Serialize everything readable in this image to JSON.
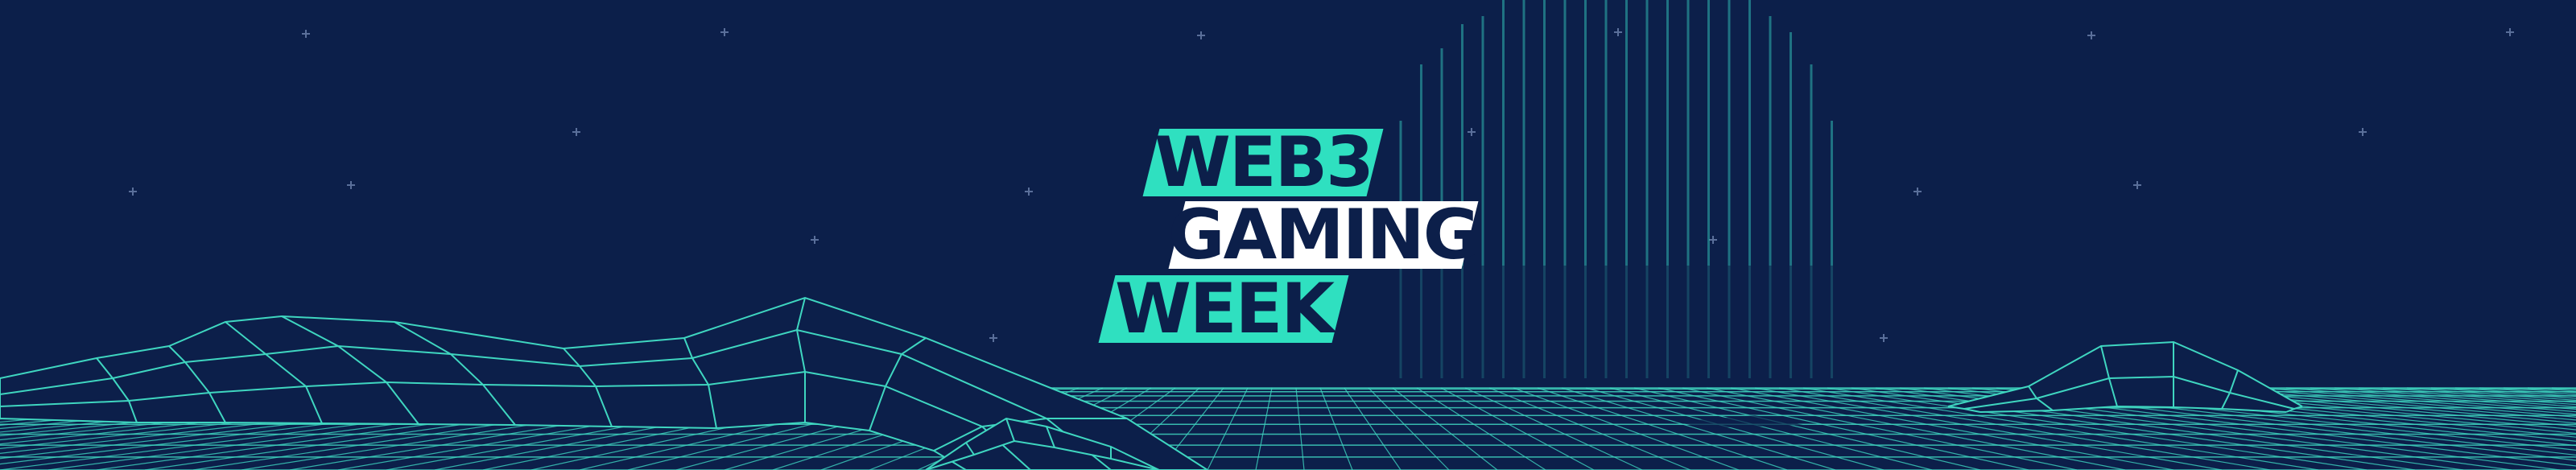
{
  "logo": {
    "line1": "WEB3",
    "line2": "GAMING",
    "line3": "WEEK"
  },
  "colors": {
    "background": "#0c1f4a",
    "accent": "#2fe0c0",
    "grid": "#3fd6c0",
    "logo_text": "#0c1f4a",
    "logo_white_bar": "#ffffff"
  }
}
